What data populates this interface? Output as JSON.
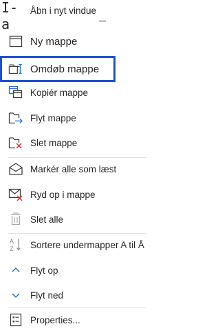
{
  "menu": {
    "items": [
      {
        "id": "open-new-window",
        "label": "Åbn i nyt vindue",
        "icon": "open-new-window-icon"
      },
      {
        "id": "new-folder",
        "label": "Ny mappe",
        "icon": "new-folder-icon"
      },
      {
        "id": "rename-folder",
        "label": "Omdøb mappe",
        "icon": "rename-folder-icon",
        "selected": true
      },
      {
        "id": "copy-folder",
        "label": "Kopiér mappe",
        "icon": "copy-folder-icon"
      },
      {
        "id": "move-folder",
        "label": "Flyt mappe",
        "icon": "move-folder-icon"
      },
      {
        "id": "delete-folder",
        "label": "Slet mappe",
        "icon": "delete-folder-icon"
      },
      {
        "id": "mark-all-read",
        "label": "Markér alle som læst",
        "icon": "mark-read-icon"
      },
      {
        "id": "clean-up-folder",
        "label": "Ryd op i mappe",
        "icon": "clean-up-icon"
      },
      {
        "id": "delete-all",
        "label": "Slet alle",
        "icon": "delete-all-icon"
      },
      {
        "id": "sort-subfolders",
        "label": "Sortere undermapper A til Å",
        "icon": "sort-az-icon"
      },
      {
        "id": "move-up",
        "label": "Flyt op",
        "icon": "chevron-up-icon"
      },
      {
        "id": "move-down",
        "label": "Flyt ned",
        "icon": "chevron-down-icon"
      },
      {
        "id": "properties",
        "label": "Properties...",
        "icon": "properties-icon"
      }
    ],
    "first_icon_glyph": "I-a",
    "colors": {
      "selection_border": "#1f4fd1",
      "accent_blue": "#2f6fd6",
      "delete_red": "#d13438",
      "text": "#262626",
      "icon": "#404040"
    }
  }
}
